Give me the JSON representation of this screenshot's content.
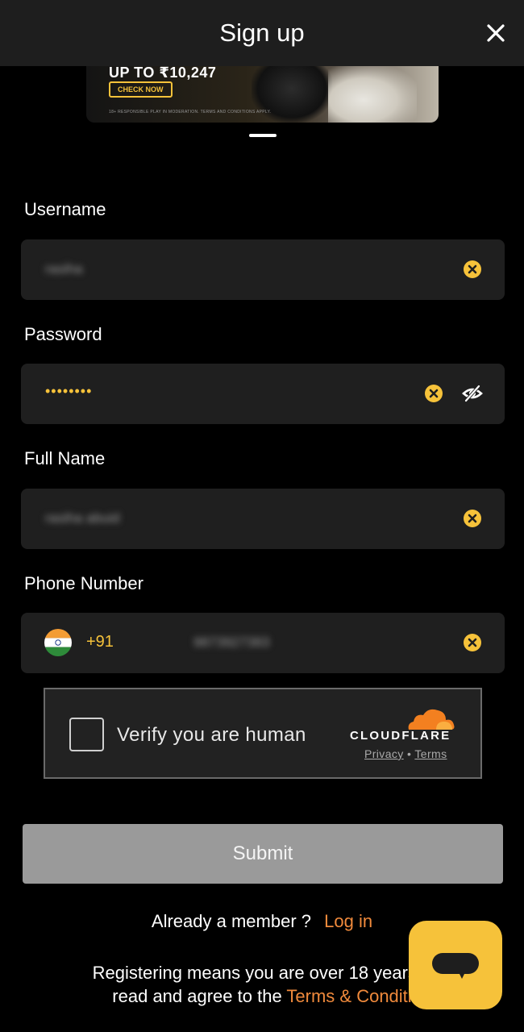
{
  "header": {
    "title": "Sign up"
  },
  "banner": {
    "headline": "UP TO ₹10,247",
    "cta_label": "CHECK NOW",
    "fine_print": "18+ RESPONSIBLE PLAY IN MODERATION. TERMS AND CONDITIONS APPLY."
  },
  "form": {
    "username": {
      "label": "Username",
      "value": "rasiha"
    },
    "password": {
      "label": "Password",
      "masked_value": "••••••••"
    },
    "full_name": {
      "label": "Full Name",
      "value": "rasiha abuid"
    },
    "phone": {
      "label": "Phone Number",
      "dial_code": "+91",
      "value": "9873927383"
    }
  },
  "captcha": {
    "label": "Verify you are human",
    "brand": "CLOUDFLARE",
    "privacy_link": "Privacy",
    "separator": "•",
    "terms_link": "Terms"
  },
  "submit_label": "Submit",
  "member": {
    "text": "Already a member ?",
    "login_link": "Log in"
  },
  "legal": {
    "line1": "Registering means you are over 18 years o",
    "line2_prefix": "read and agree to the",
    "terms_link": "Terms & Conditi"
  },
  "colors": {
    "accent": "#f6c23a",
    "link": "#f08a3c",
    "field_bg": "#1f1f1f",
    "header_bg": "#1e1e1e"
  },
  "icons": {
    "close": "close-icon",
    "clear": "clear-icon",
    "eye": "eye-slash-icon",
    "flag": "india-flag-icon",
    "cloud": "cloudflare-logo-icon",
    "chat": "chat-icon"
  }
}
